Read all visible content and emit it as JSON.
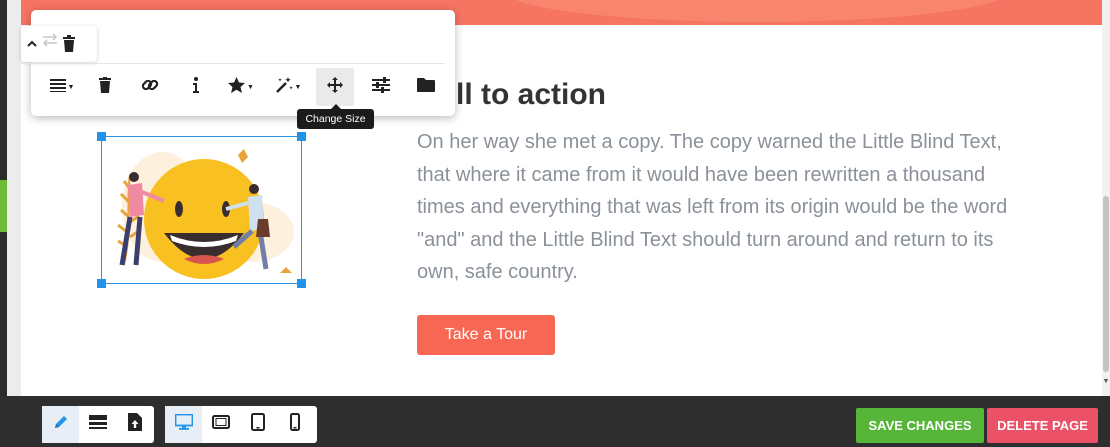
{
  "content": {
    "heading": "ll to action",
    "paragraph": "On her way she met a copy. The copy warned the Little Blind Text, that where it came from it would have been rewritten a thousand times and everything that was left from its origin would be the word \"and\" and the Little Blind Text should turn around and return to its own, safe country.",
    "button_label": "Take a Tour"
  },
  "toolbar": {
    "tooltip": "Change Size",
    "top_icons": [
      "chevron-up-icon",
      "swap-icon",
      "trash-icon"
    ],
    "buttons": [
      "align-icon",
      "trash-icon",
      "link-icon",
      "info-icon",
      "star-icon",
      "magic-wand-icon",
      "move-icon",
      "sliders-icon",
      "folder-icon"
    ],
    "active_button": "move-icon"
  },
  "bottom_bar": {
    "mode_buttons": [
      "pencil-icon",
      "sections-icon",
      "file-upload-icon"
    ],
    "device_buttons": [
      "desktop-icon",
      "tablet-landscape-icon",
      "tablet-icon",
      "phone-icon"
    ],
    "save_label": "SAVE CHANGES",
    "delete_label": "DELETE PAGE"
  },
  "colors": {
    "banner": "#f67462",
    "accent_button": "#f76753",
    "save": "#57b63a",
    "delete": "#ec5267",
    "selection": "#2193e8"
  }
}
